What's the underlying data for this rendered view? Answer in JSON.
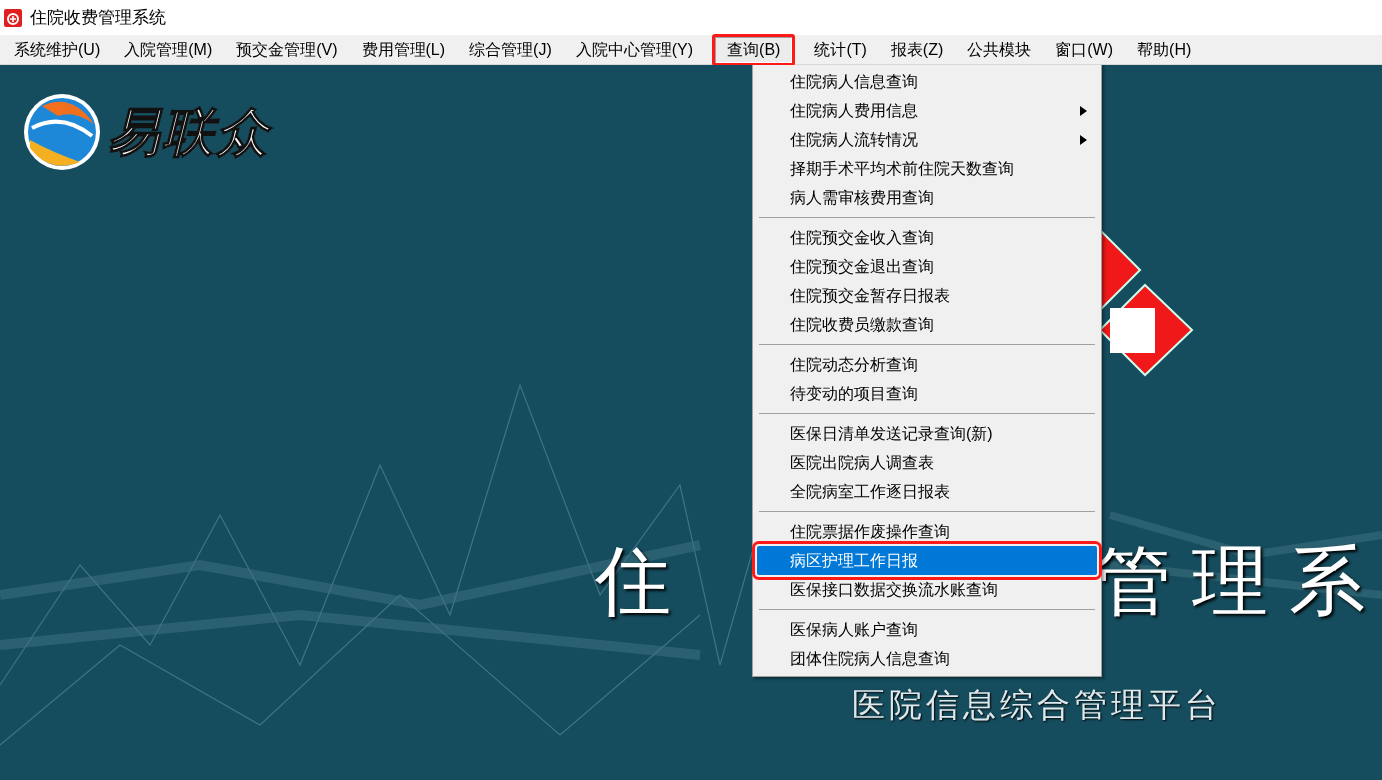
{
  "window": {
    "title": "住院收费管理系统"
  },
  "menu_bar": [
    {
      "label": "系统维护(U)",
      "open": false,
      "highlighted": false
    },
    {
      "label": "入院管理(M)",
      "open": false,
      "highlighted": false
    },
    {
      "label": "预交金管理(V)",
      "open": false,
      "highlighted": false
    },
    {
      "label": "费用管理(L)",
      "open": false,
      "highlighted": false
    },
    {
      "label": "综合管理(J)",
      "open": false,
      "highlighted": false
    },
    {
      "label": "入院中心管理(Y)",
      "open": false,
      "highlighted": false
    },
    {
      "label": "查询(B)",
      "open": true,
      "highlighted": true
    },
    {
      "label": "统计(T)",
      "open": false,
      "highlighted": false
    },
    {
      "label": "报表(Z)",
      "open": false,
      "highlighted": false
    },
    {
      "label": "公共模块",
      "open": false,
      "highlighted": false
    },
    {
      "label": "窗口(W)",
      "open": false,
      "highlighted": false
    },
    {
      "label": "帮助(H)",
      "open": false,
      "highlighted": false
    }
  ],
  "splash": {
    "brand": "易联众",
    "title_left": "住",
    "title_right": "管 理 系",
    "subtitle": "医院信息综合管理平台"
  },
  "dropdown": {
    "groups": [
      [
        {
          "label": "住院病人信息查询",
          "has_submenu": false,
          "selected": false,
          "highlighted": false
        },
        {
          "label": "住院病人费用信息",
          "has_submenu": true,
          "selected": false,
          "highlighted": false
        },
        {
          "label": "住院病人流转情况",
          "has_submenu": true,
          "selected": false,
          "highlighted": false
        },
        {
          "label": "择期手术平均术前住院天数查询",
          "has_submenu": false,
          "selected": false,
          "highlighted": false
        },
        {
          "label": "病人需审核费用查询",
          "has_submenu": false,
          "selected": false,
          "highlighted": false
        }
      ],
      [
        {
          "label": "住院预交金收入查询",
          "has_submenu": false,
          "selected": false,
          "highlighted": false
        },
        {
          "label": "住院预交金退出查询",
          "has_submenu": false,
          "selected": false,
          "highlighted": false
        },
        {
          "label": "住院预交金暂存日报表",
          "has_submenu": false,
          "selected": false,
          "highlighted": false
        },
        {
          "label": "住院收费员缴款查询",
          "has_submenu": false,
          "selected": false,
          "highlighted": false
        }
      ],
      [
        {
          "label": "住院动态分析查询",
          "has_submenu": false,
          "selected": false,
          "highlighted": false
        },
        {
          "label": "待变动的项目查询",
          "has_submenu": false,
          "selected": false,
          "highlighted": false
        }
      ],
      [
        {
          "label": "医保日清单发送记录查询(新)",
          "has_submenu": false,
          "selected": false,
          "highlighted": false
        },
        {
          "label": "医院出院病人调查表",
          "has_submenu": false,
          "selected": false,
          "highlighted": false
        },
        {
          "label": "全院病室工作逐日报表",
          "has_submenu": false,
          "selected": false,
          "highlighted": false
        }
      ],
      [
        {
          "label": "住院票据作废操作查询",
          "has_submenu": false,
          "selected": false,
          "highlighted": false
        },
        {
          "label": "病区护理工作日报",
          "has_submenu": false,
          "selected": true,
          "highlighted": true
        },
        {
          "label": "医保接口数据交换流水账查询",
          "has_submenu": false,
          "selected": false,
          "highlighted": false
        }
      ],
      [
        {
          "label": "医保病人账户查询",
          "has_submenu": false,
          "selected": false,
          "highlighted": false
        },
        {
          "label": "团体住院病人信息查询",
          "has_submenu": false,
          "selected": false,
          "highlighted": false
        }
      ]
    ]
  }
}
